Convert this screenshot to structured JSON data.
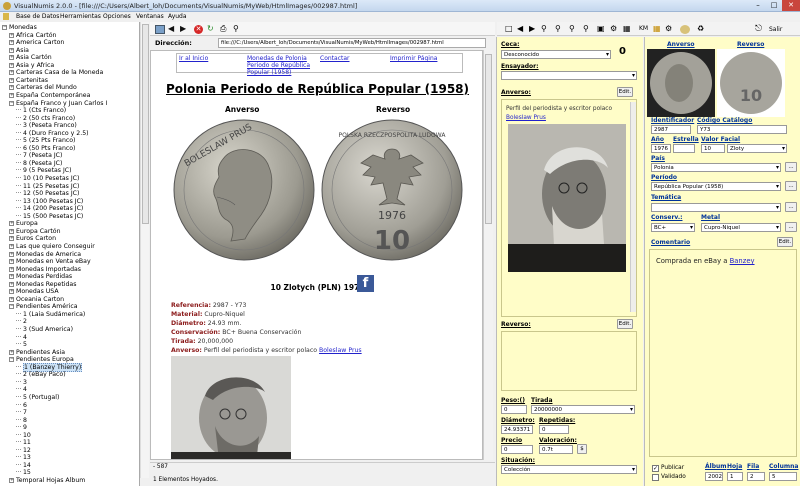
{
  "window": {
    "title": "VisualNumis 2.0.0 - [file:///C:/Users/Albert_loh/Documents/VisualNumis/MyWeb/HtmlImages/002987.html]",
    "controls": [
      "–",
      "□",
      "✕"
    ]
  },
  "menu": [
    "Base de Datos",
    "Herramientas",
    "Opciones",
    "Ventanas",
    "Ayuda"
  ],
  "tree": [
    {
      "label": "Monedas",
      "level": 0,
      "pm": "−"
    },
    {
      "label": "Africa Cartón",
      "level": 1,
      "pm": "+"
    },
    {
      "label": "America Carton",
      "level": 1,
      "pm": "+"
    },
    {
      "label": "Asia",
      "level": 1,
      "pm": "+"
    },
    {
      "label": "Asia Cartón",
      "level": 1,
      "pm": "+"
    },
    {
      "label": "Asia y Africa",
      "level": 1,
      "pm": "+"
    },
    {
      "label": "Carteras Casa de la Moneda",
      "level": 1,
      "pm": "+"
    },
    {
      "label": "Cartenitas",
      "level": 1,
      "pm": "+"
    },
    {
      "label": "Carteras del Mundo",
      "level": 1,
      "pm": "+"
    },
    {
      "label": "España Contemporánea",
      "level": 1,
      "pm": "+"
    },
    {
      "label": "España Franco y Juan Carlos I",
      "level": 1,
      "pm": "−"
    },
    {
      "label": "1 (Cts Franco)",
      "level": 2
    },
    {
      "label": "2 (50 cts Franco)",
      "level": 2
    },
    {
      "label": "3 (Peseta Franco)",
      "level": 2
    },
    {
      "label": "4 (Duro Franco y 2.5)",
      "level": 2
    },
    {
      "label": "5 (25 Pts Franco)",
      "level": 2
    },
    {
      "label": "6 (50 Pts Franco)",
      "level": 2
    },
    {
      "label": "7 (Peseta JC)",
      "level": 2
    },
    {
      "label": "8 (Peseta JC)",
      "level": 2
    },
    {
      "label": "9 (5 Pesetas JC)",
      "level": 2
    },
    {
      "label": "10 (10 Pesetas JC)",
      "level": 2
    },
    {
      "label": "11 (25 Pesetas JC)",
      "level": 2
    },
    {
      "label": "12 (50 Pesetas JC)",
      "level": 2
    },
    {
      "label": "13 (100 Pesetas JC)",
      "level": 2
    },
    {
      "label": "14 (200 Pesetas JC)",
      "level": 2
    },
    {
      "label": "15 (500 Pesetas JC)",
      "level": 2
    },
    {
      "label": "Europa",
      "level": 1,
      "pm": "+"
    },
    {
      "label": "Europa Cartón",
      "level": 1,
      "pm": "+"
    },
    {
      "label": "Euros Carton",
      "level": 1,
      "pm": "+"
    },
    {
      "label": "Las que quiero Conseguir",
      "level": 1,
      "pm": "+"
    },
    {
      "label": "Monedas de America",
      "level": 1,
      "pm": "+"
    },
    {
      "label": "Monedas en Venta eBay",
      "level": 1,
      "pm": "+"
    },
    {
      "label": "Monedas Importadas",
      "level": 1,
      "pm": "+"
    },
    {
      "label": "Monedas Perdidas",
      "level": 1,
      "pm": "+"
    },
    {
      "label": "Monedas Repetidas",
      "level": 1,
      "pm": "+"
    },
    {
      "label": "Monedas USA",
      "level": 1,
      "pm": "+"
    },
    {
      "label": "Oceania Carton",
      "level": 1,
      "pm": "+"
    },
    {
      "label": "Pendientes América",
      "level": 1,
      "pm": "−"
    },
    {
      "label": "1 (Laia Sudámerica)",
      "level": 2
    },
    {
      "label": "2",
      "level": 2
    },
    {
      "label": "3 (Sud America)",
      "level": 2
    },
    {
      "label": "4",
      "level": 2
    },
    {
      "label": "5",
      "level": 2
    },
    {
      "label": "Pendientes Asia",
      "level": 1,
      "pm": "+"
    },
    {
      "label": "Pendientes Europa",
      "level": 1,
      "pm": "−"
    },
    {
      "label": "1 (Banzey Thierry)",
      "level": 2,
      "selected": true
    },
    {
      "label": "2 (eBay Paco)",
      "level": 2
    },
    {
      "label": "3",
      "level": 2
    },
    {
      "label": "4",
      "level": 2
    },
    {
      "label": "5 (Portugal)",
      "level": 2
    },
    {
      "label": "6",
      "level": 2
    },
    {
      "label": "7",
      "level": 2
    },
    {
      "label": "8",
      "level": 2
    },
    {
      "label": "9",
      "level": 2
    },
    {
      "label": "10",
      "level": 2
    },
    {
      "label": "11",
      "level": 2
    },
    {
      "label": "12",
      "level": 2
    },
    {
      "label": "13",
      "level": 2
    },
    {
      "label": "14",
      "level": 2
    },
    {
      "label": "15",
      "level": 2
    },
    {
      "label": "Temporal Hojas Album",
      "level": 1,
      "pm": "+"
    }
  ],
  "address": {
    "label": "Dirección:",
    "value": "file:///C:/Users/Albert_loh/Documents/VisualNumis/MyWeb/HtmlImages/002987.html"
  },
  "webpage": {
    "nav": [
      "Ir al Inicio",
      "Monedas de Polonia Periodo de República Popular (1958)",
      "Contactar",
      "Imprimir Página"
    ],
    "title": "Polonia Periodo de República Popular (1958)",
    "obverse_label": "Anverso",
    "reverse_label": "Reverso",
    "coin_name": "10 Zlotych (PLN) 1976",
    "fb": "f",
    "details": [
      {
        "k": "Referencia:",
        "v": "2987 - Y73"
      },
      {
        "k": "Material:",
        "v": "Cupro-Niquel"
      },
      {
        "k": "Diámetro:",
        "v": "24.93 mm."
      },
      {
        "k": "Conservación:",
        "v": "BC+ Buena Conservación"
      },
      {
        "k": "Tirada:",
        "v": "20,000,000"
      },
      {
        "k": "Anverso:",
        "v": "Perfil del periodista y escritor polaco ",
        "link": "Boleslaw Prus"
      }
    ],
    "coin_obv_text": "BOLESLAW PRUS",
    "coin_rev_text": "POLSKA RZECZPOSPOLITA LUDOWA",
    "coin_year": "1976",
    "coin_value": "10"
  },
  "statusbar": "- 587",
  "bottom_status": "1 Elementos Hoyados.",
  "mid": {
    "ceca_label": "Ceca:",
    "ceca_value": "Desconocido",
    "count": "0",
    "ensayador_label": "Ensayador:",
    "anverso_label": "Anverso:",
    "edit_label": "Edit.",
    "anverso_text": "Perfil del periodista y escritor polaco ",
    "anverso_link": "Boleslaw Prus",
    "reverso_label": "Reverso:",
    "peso_label": "Peso:()",
    "peso_value": "0",
    "tirada_label": "Tirada",
    "tirada_value": "20000000",
    "diametro_label": "Diámetro:",
    "diametro_value": "24.93371",
    "repetidas_label": "Repetidas:",
    "repetidas_value": "0",
    "precio_label": "Precio",
    "precio_value": "0",
    "valoracion_label": "Valoración:",
    "valoracion_value": "0.7t",
    "dollar": "$",
    "situacion_label": "Situación:",
    "situacion_value": "Colección"
  },
  "right": {
    "anverso": "Anverso",
    "reverso": "Reverso",
    "identificador_label": "Identificador",
    "identificador_value": "2987",
    "codigo_label": "Código Catálogo",
    "codigo_value": "Y73",
    "ano_label": "Año",
    "ano_value": "1976",
    "estrella_label": "Estrella",
    "valor_label": "Valor Facial",
    "valor_value": "10",
    "valor_unit": "Zloty",
    "pais_label": "País",
    "pais_value": "Polonia",
    "periodo_label": "Período",
    "periodo_value": "República Popular (1958)",
    "tematica_label": "Temática",
    "conserv_label": "Conserv.:",
    "conserv_value": "BC+",
    "metal_label": "Metal",
    "metal_value": "Cupro-Niquel",
    "comentario_label": "Comentario",
    "edit_label": "Edit.",
    "comentario_text": "Comprada en eBay a ",
    "comentario_link": "Banzey",
    "publicar_label": "Publicar",
    "validado_label": "Validado",
    "album_label": "Álbum",
    "album_value": "2002",
    "hoja_label": "Hoja",
    "hoja_value": "1",
    "fila_label": "Fila",
    "fila_value": "2",
    "columna_label": "Columna",
    "columna_value": "5",
    "dots": "...",
    "salir": "Salir"
  },
  "toolbar_icons": [
    "logo-icon",
    "back-icon",
    "forward-icon",
    "stop-icon",
    "refresh-icon",
    "print-icon",
    "search-icon"
  ]
}
